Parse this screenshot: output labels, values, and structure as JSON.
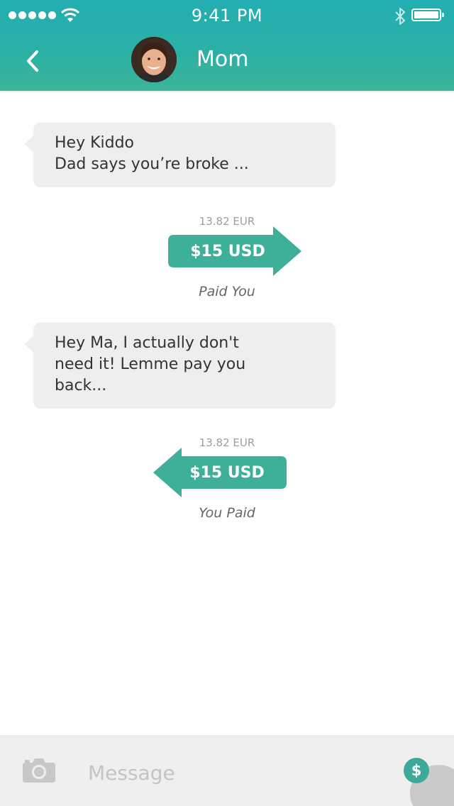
{
  "status_bar": {
    "time": "9:41 PM"
  },
  "header": {
    "contact_name": "Mom"
  },
  "messages": [
    {
      "line1": "Hey Kiddo",
      "line2": "Dad says you’re broke ..."
    },
    {
      "line1": "Hey Ma, I actually don't",
      "line2": "need it! Lemme pay you",
      "line3": "back..."
    }
  ],
  "payments": [
    {
      "converted": "13.82 EUR",
      "amount": "$15 USD",
      "caption": "Paid You",
      "direction": "received"
    },
    {
      "converted": "13.82 EUR",
      "amount": "$15 USD",
      "caption": "You Paid",
      "direction": "sent"
    }
  ],
  "composer": {
    "placeholder": "Message",
    "pay_symbol": "$"
  },
  "colors": {
    "accent": "#3eb09a",
    "header_top": "#22aeb2",
    "bubble": "#eeeeee"
  },
  "icons": [
    "back-chevron-icon",
    "camera-icon",
    "dollar-icon",
    "wifi-icon",
    "bluetooth-icon",
    "battery-icon"
  ]
}
